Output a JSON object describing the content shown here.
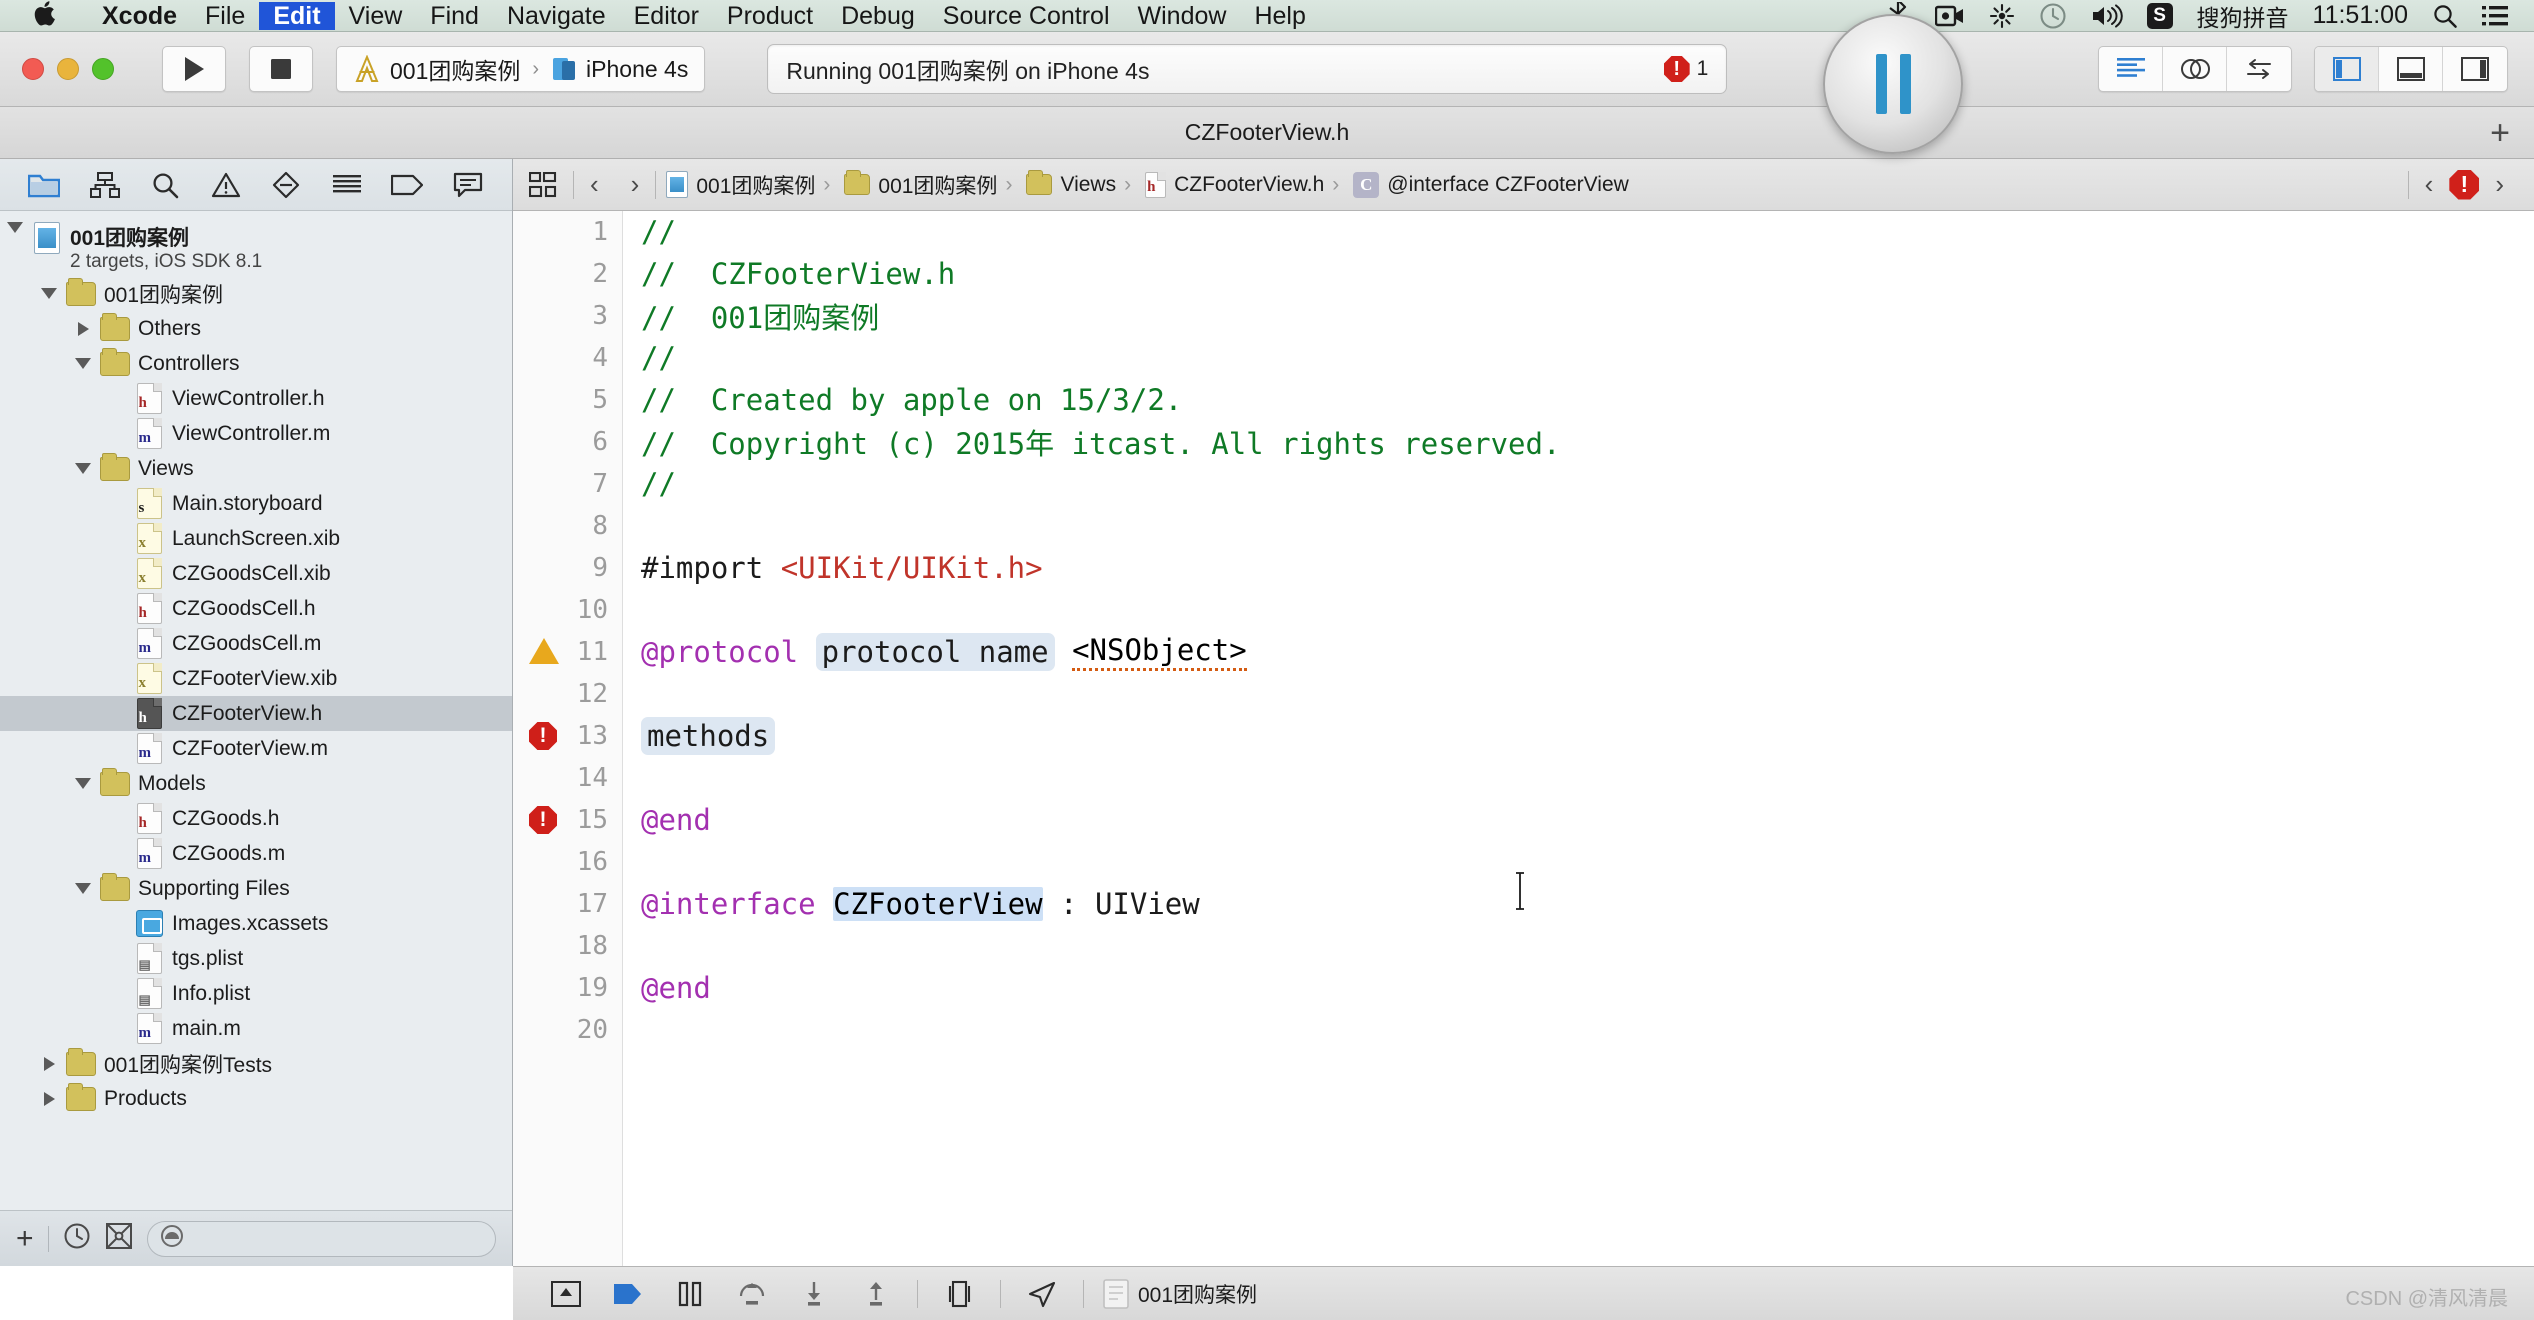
{
  "menubar": {
    "apple_icon": "apple-logo-icon",
    "items": [
      {
        "label": "Xcode",
        "bold": true,
        "active": false
      },
      {
        "label": "File",
        "bold": false,
        "active": false
      },
      {
        "label": "Edit",
        "bold": false,
        "active": true
      },
      {
        "label": "View",
        "bold": false,
        "active": false
      },
      {
        "label": "Find",
        "bold": false,
        "active": false
      },
      {
        "label": "Navigate",
        "bold": false,
        "active": false
      },
      {
        "label": "Editor",
        "bold": false,
        "active": false
      },
      {
        "label": "Product",
        "bold": false,
        "active": false
      },
      {
        "label": "Debug",
        "bold": false,
        "active": false
      },
      {
        "label": "Source Control",
        "bold": false,
        "active": false
      },
      {
        "label": "Window",
        "bold": false,
        "active": false
      },
      {
        "label": "Help",
        "bold": false,
        "active": false
      }
    ],
    "status": {
      "bluetooth_icon": "bluetooth-icon",
      "screen_record_icon": "screen-record-icon",
      "airplay_icon": "airplay-icon",
      "timemachine_icon": "time-machine-icon",
      "volume_icon": "volume-icon",
      "input_badge": "S",
      "input_method": "搜狗拼音",
      "clock": "11:51:00",
      "spotlight_icon": "search-icon",
      "notification_icon": "notification-center-icon"
    },
    "active_highlight_color": "#2055d8"
  },
  "toolbar": {
    "window_controls": [
      "close",
      "minimize",
      "zoom"
    ],
    "run_icon": "play-icon",
    "stop_icon": "stop-icon",
    "scheme": {
      "scheme_icon": "xcode-scheme-icon",
      "scheme_name": "001团购案例",
      "separator": "›",
      "device_icon": "simulator-icon",
      "device_name": "iPhone 4s"
    },
    "activity": {
      "text": "Running 001团购案例 on iPhone 4s",
      "error_count": "1",
      "error_icon": "error-octagon-icon"
    },
    "editor_segments": [
      {
        "name": "standard-editor",
        "icon": "standard-editor-icon",
        "selected": false
      },
      {
        "name": "assistant-editor",
        "icon": "assistant-editor-icon",
        "selected": false
      },
      {
        "name": "version-editor",
        "icon": "version-editor-icon",
        "selected": false
      }
    ],
    "view_segments": [
      {
        "name": "toggle-navigator",
        "icon": "left-panel-icon",
        "selected": true
      },
      {
        "name": "toggle-debug-area",
        "icon": "bottom-panel-icon",
        "selected": false
      },
      {
        "name": "toggle-utilities",
        "icon": "right-panel-icon",
        "selected": false
      }
    ],
    "pause_overlay_icon": "pause-icon"
  },
  "tabbar": {
    "active_tab": "CZFooterView.h",
    "add_tab_label": "+"
  },
  "navigator": {
    "toolbar_icons": [
      {
        "name": "project-navigator-icon",
        "selected": true
      },
      {
        "name": "symbol-navigator-icon",
        "selected": false
      },
      {
        "name": "find-navigator-icon",
        "selected": false
      },
      {
        "name": "issue-navigator-icon",
        "selected": false
      },
      {
        "name": "test-navigator-icon",
        "selected": false
      },
      {
        "name": "debug-navigator-icon",
        "selected": false
      },
      {
        "name": "breakpoint-navigator-icon",
        "selected": false
      },
      {
        "name": "report-navigator-icon",
        "selected": false
      }
    ],
    "tree": [
      {
        "label": "001团购案例",
        "sublabel": "2 targets, iOS SDK 8.1",
        "depth": 0,
        "icon": "project-icon",
        "twisty": "open",
        "bold": true,
        "selected": false
      },
      {
        "label": "001团购案例",
        "depth": 1,
        "icon": "folder",
        "twisty": "open",
        "selected": false
      },
      {
        "label": "Others",
        "depth": 2,
        "icon": "folder",
        "twisty": "closed",
        "selected": false
      },
      {
        "label": "Controllers",
        "depth": 2,
        "icon": "folder",
        "twisty": "open",
        "selected": false
      },
      {
        "label": "ViewController.h",
        "depth": 3,
        "icon": "h",
        "twisty": "none",
        "selected": false
      },
      {
        "label": "ViewController.m",
        "depth": 3,
        "icon": "m",
        "twisty": "none",
        "selected": false
      },
      {
        "label": "Views",
        "depth": 2,
        "icon": "folder",
        "twisty": "open",
        "selected": false
      },
      {
        "label": "Main.storyboard",
        "depth": 3,
        "icon": "storyboard",
        "twisty": "none",
        "selected": false
      },
      {
        "label": "LaunchScreen.xib",
        "depth": 3,
        "icon": "xib",
        "twisty": "none",
        "selected": false
      },
      {
        "label": "CZGoodsCell.xib",
        "depth": 3,
        "icon": "xib",
        "twisty": "none",
        "selected": false
      },
      {
        "label": "CZGoodsCell.h",
        "depth": 3,
        "icon": "h",
        "twisty": "none",
        "selected": false
      },
      {
        "label": "CZGoodsCell.m",
        "depth": 3,
        "icon": "m",
        "twisty": "none",
        "selected": false
      },
      {
        "label": "CZFooterView.xib",
        "depth": 3,
        "icon": "xib",
        "twisty": "none",
        "selected": false
      },
      {
        "label": "CZFooterView.h",
        "depth": 3,
        "icon": "h-selected",
        "twisty": "none",
        "selected": true
      },
      {
        "label": "CZFooterView.m",
        "depth": 3,
        "icon": "m",
        "twisty": "none",
        "selected": false
      },
      {
        "label": "Models",
        "depth": 2,
        "icon": "folder",
        "twisty": "open",
        "selected": false
      },
      {
        "label": "CZGoods.h",
        "depth": 3,
        "icon": "h",
        "twisty": "none",
        "selected": false
      },
      {
        "label": "CZGoods.m",
        "depth": 3,
        "icon": "m",
        "twisty": "none",
        "selected": false
      },
      {
        "label": "Supporting Files",
        "depth": 2,
        "icon": "folder",
        "twisty": "open",
        "selected": false
      },
      {
        "label": "Images.xcassets",
        "depth": 3,
        "icon": "xcassets",
        "twisty": "none",
        "selected": false
      },
      {
        "label": "tgs.plist",
        "depth": 3,
        "icon": "plist",
        "twisty": "none",
        "selected": false
      },
      {
        "label": "Info.plist",
        "depth": 3,
        "icon": "plist",
        "twisty": "none",
        "selected": false
      },
      {
        "label": "main.m",
        "depth": 3,
        "icon": "m",
        "twisty": "none",
        "selected": false
      },
      {
        "label": "001团购案例Tests",
        "depth": 1,
        "icon": "folder",
        "twisty": "closed",
        "selected": false
      },
      {
        "label": "Products",
        "depth": 1,
        "icon": "folder",
        "twisty": "closed",
        "selected": false
      }
    ],
    "filterbar": {
      "add_label": "+",
      "recent_icon": "clock-icon",
      "source_control_icon": "source-control-filter-icon",
      "filter_placeholder": "",
      "filter_value": "",
      "filter_icon": "filter-icon"
    }
  },
  "jumpbar": {
    "related_items_icon": "related-items-icon",
    "back_arrow": "‹",
    "forward_arrow": "›",
    "crumbs": [
      {
        "label": "001团购案例",
        "icon": "project-icon"
      },
      {
        "label": "001团购案例",
        "icon": "folder"
      },
      {
        "label": "Views",
        "icon": "folder"
      },
      {
        "label": "CZFooterView.h",
        "icon": "h"
      },
      {
        "label": "@interface CZFooterView",
        "icon": "c-symbol"
      }
    ],
    "separator": "›",
    "prev_issue_arrow": "‹",
    "issue_icon": "error-octagon-icon",
    "next_issue_arrow": "›"
  },
  "editor": {
    "lines": [
      {
        "n": "1",
        "marker": "none",
        "tokens": [
          {
            "t": "//",
            "c": "tk-comment"
          }
        ]
      },
      {
        "n": "2",
        "marker": "none",
        "tokens": [
          {
            "t": "//  CZFooterView.h",
            "c": "tk-comment"
          }
        ]
      },
      {
        "n": "3",
        "marker": "none",
        "tokens": [
          {
            "t": "//  001团购案例",
            "c": "tk-comment"
          }
        ]
      },
      {
        "n": "4",
        "marker": "none",
        "tokens": [
          {
            "t": "//",
            "c": "tk-comment"
          }
        ]
      },
      {
        "n": "5",
        "marker": "none",
        "tokens": [
          {
            "t": "//  Created by apple on 15/3/2.",
            "c": "tk-comment"
          }
        ]
      },
      {
        "n": "6",
        "marker": "none",
        "tokens": [
          {
            "t": "//  Copyright (c) 2015年 itcast. All rights reserved.",
            "c": "tk-comment"
          }
        ]
      },
      {
        "n": "7",
        "marker": "none",
        "tokens": [
          {
            "t": "//",
            "c": "tk-comment"
          }
        ]
      },
      {
        "n": "8",
        "marker": "none",
        "tokens": []
      },
      {
        "n": "9",
        "marker": "none",
        "tokens": [
          {
            "t": "#import ",
            "c": "tk-pre"
          },
          {
            "t": "<UIKit/UIKit.h>",
            "c": "tk-str"
          }
        ]
      },
      {
        "n": "10",
        "marker": "none",
        "tokens": []
      },
      {
        "n": "11",
        "marker": "warning",
        "tokens": [
          {
            "t": "@protocol ",
            "c": "tk-kw"
          },
          {
            "t": "protocol name",
            "c": "ph"
          },
          {
            "t": " ",
            "c": "tk-plain"
          },
          {
            "t": "<NSObject>",
            "c": "squiggle"
          }
        ]
      },
      {
        "n": "12",
        "marker": "none",
        "tokens": []
      },
      {
        "n": "13",
        "marker": "error",
        "tokens": [
          {
            "t": "methods",
            "c": "ph"
          }
        ]
      },
      {
        "n": "14",
        "marker": "none",
        "tokens": []
      },
      {
        "n": "15",
        "marker": "error",
        "tokens": [
          {
            "t": "@end",
            "c": "tk-kw"
          }
        ]
      },
      {
        "n": "16",
        "marker": "none",
        "tokens": []
      },
      {
        "n": "17",
        "marker": "none",
        "tokens": [
          {
            "t": "@interface ",
            "c": "tk-kw"
          },
          {
            "t": "CZFooterView",
            "c": "sel-token"
          },
          {
            "t": " : UIView",
            "c": "tk-plain"
          }
        ]
      },
      {
        "n": "18",
        "marker": "none",
        "tokens": []
      },
      {
        "n": "19",
        "marker": "none",
        "tokens": [
          {
            "t": "@end",
            "c": "tk-kw"
          }
        ]
      },
      {
        "n": "20",
        "marker": "none",
        "tokens": []
      }
    ],
    "colors": {
      "comment": "#0f7a26",
      "keyword": "#a330b0",
      "string": "#c0342a",
      "placeholder_bg": "#dde7f2",
      "selection_bg": "#cde0f6"
    }
  },
  "debugbar": {
    "icons": [
      {
        "name": "hide-debug-area-icon"
      },
      {
        "name": "continue-icon"
      },
      {
        "name": "pause-icon"
      },
      {
        "name": "step-over-icon"
      },
      {
        "name": "step-into-icon"
      },
      {
        "name": "step-out-icon"
      },
      {
        "name": "view-debugging-icon"
      },
      {
        "name": "location-simulate-icon"
      }
    ],
    "process_icon": "process-icon",
    "process_label": "001团购案例"
  },
  "watermark": {
    "text": "CSDN @清风清晨"
  }
}
